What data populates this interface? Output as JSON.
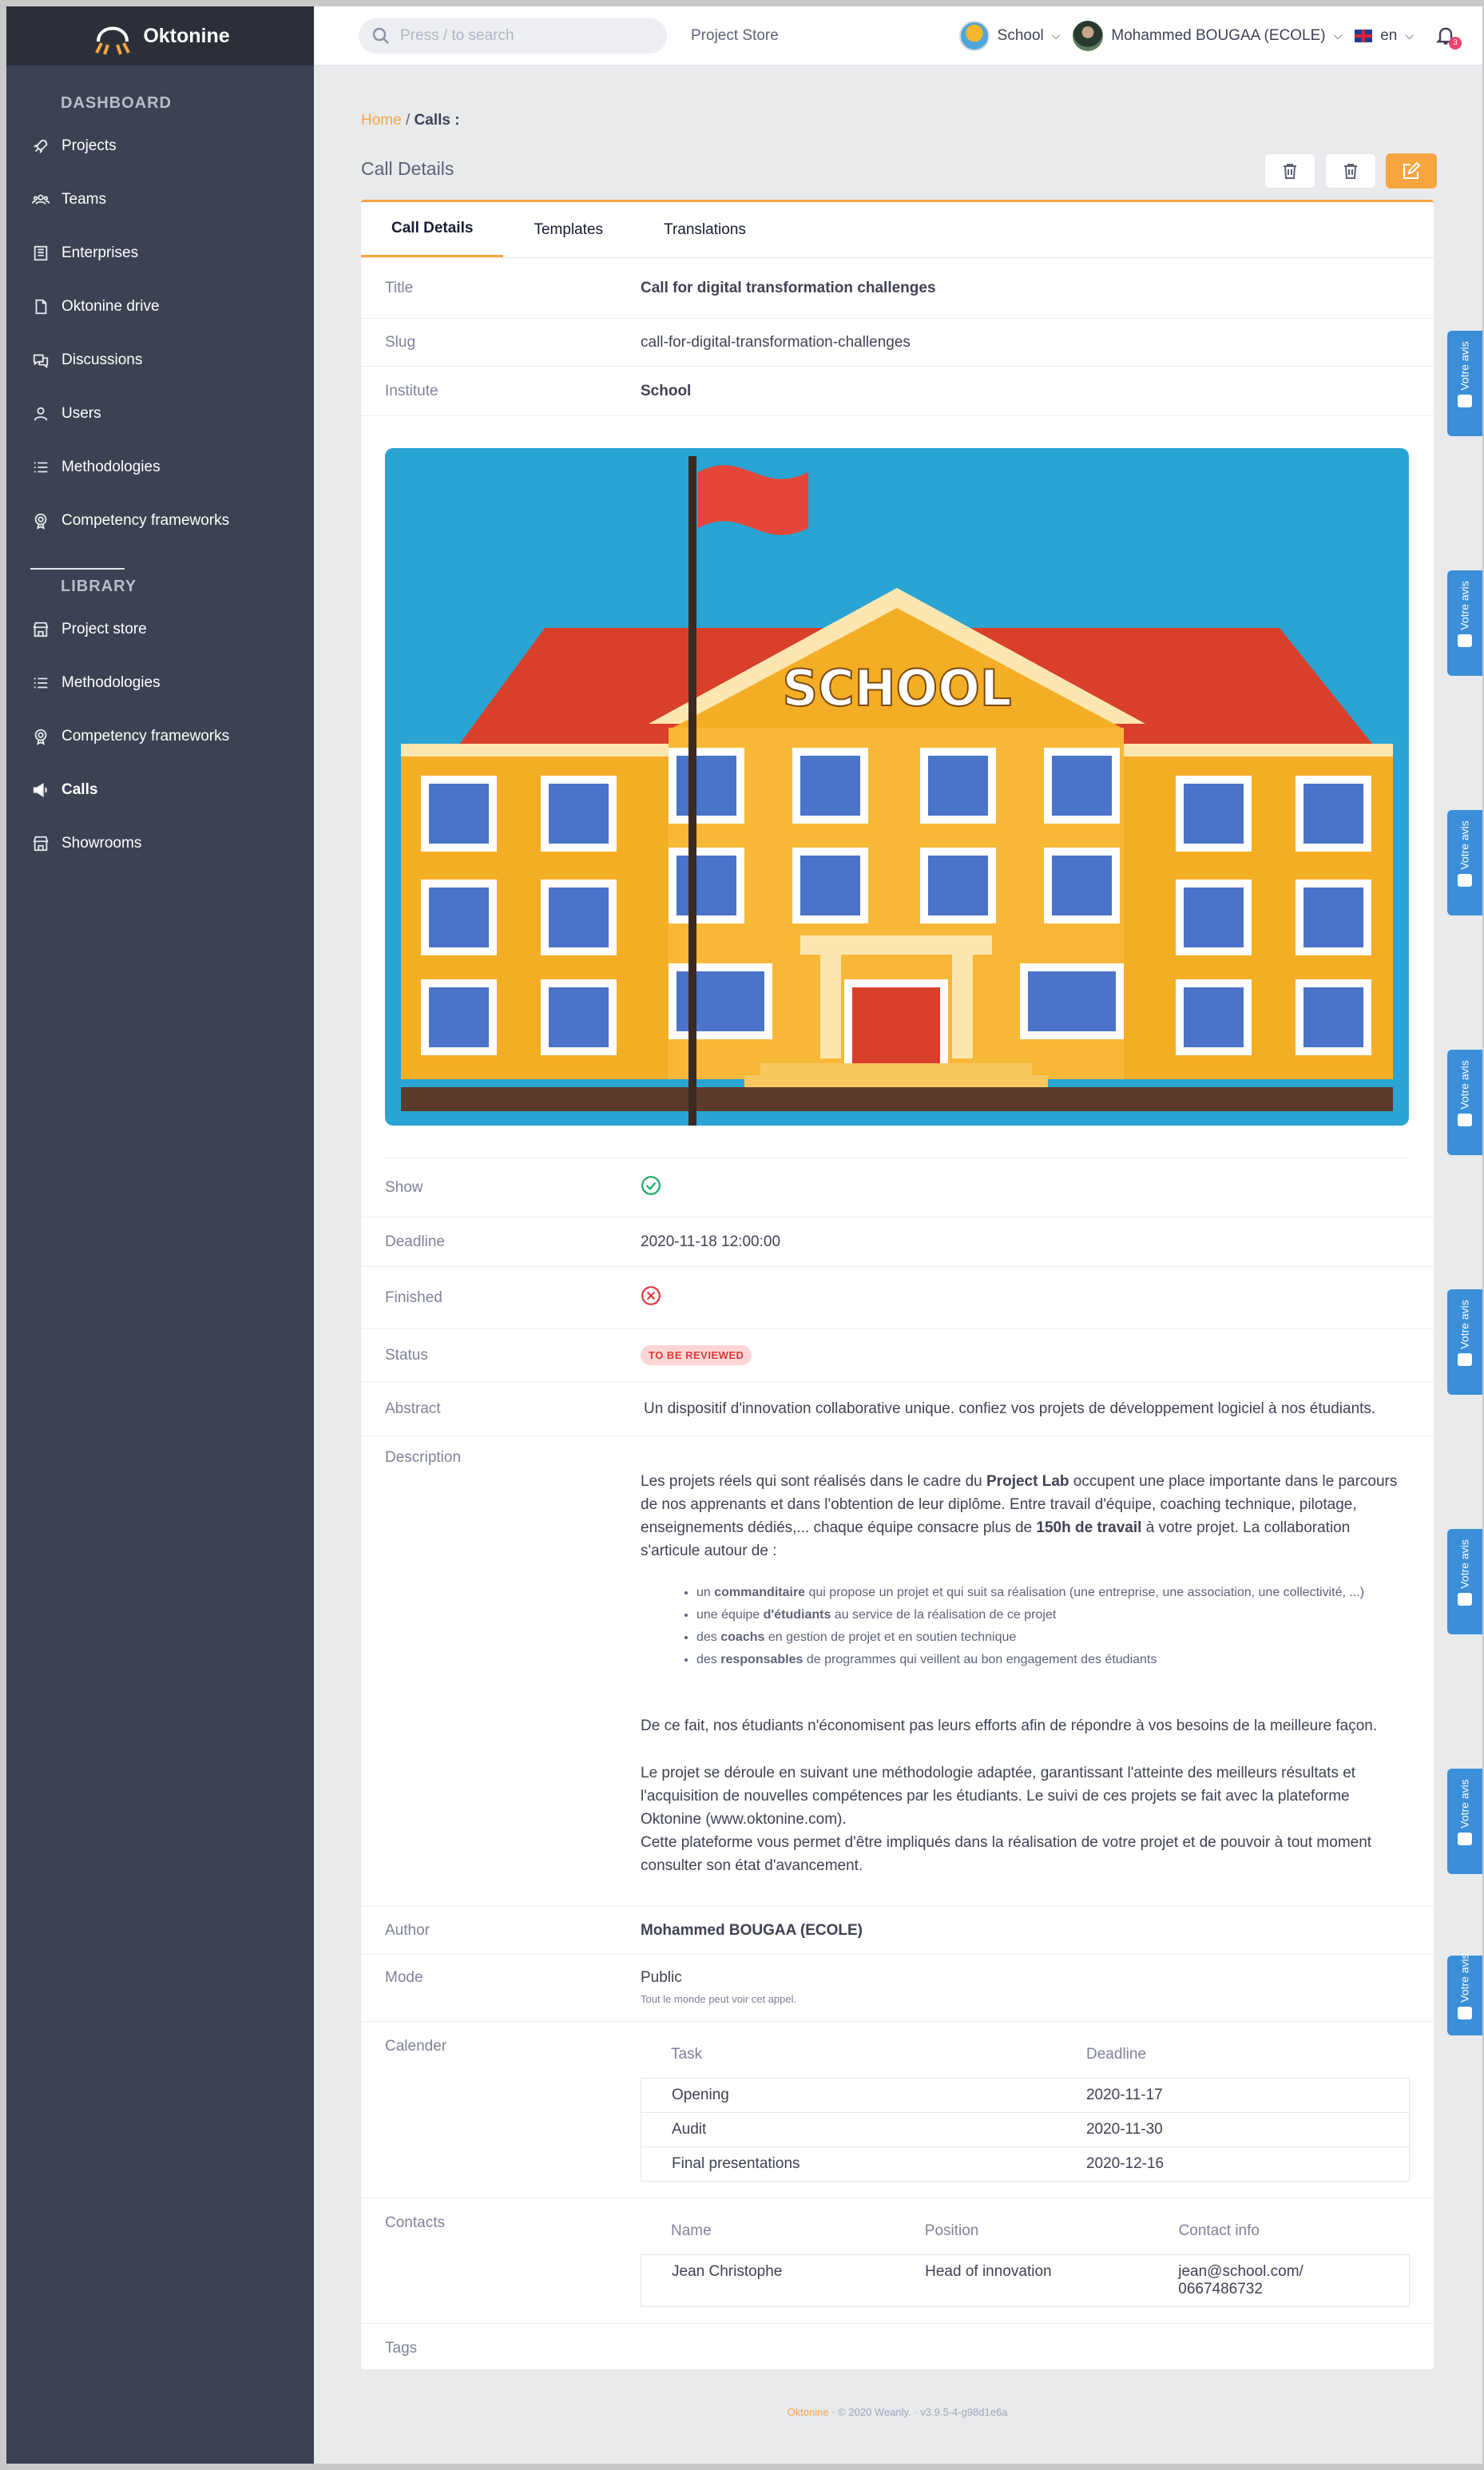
{
  "sidebar": {
    "brand": "Oktonine",
    "dashboard_title": "DASHBOARD",
    "dashboard_items": [
      {
        "label": "Projects",
        "icon": "rocket-icon"
      },
      {
        "label": "Teams",
        "icon": "users-group-icon"
      },
      {
        "label": "Enterprises",
        "icon": "building-icon"
      },
      {
        "label": "Oktonine drive",
        "icon": "drive-icon"
      },
      {
        "label": "Discussions",
        "icon": "chat-icon"
      },
      {
        "label": "Users",
        "icon": "user-icon"
      },
      {
        "label": "Methodologies",
        "icon": "list-icon"
      },
      {
        "label": "Competency frameworks",
        "icon": "badge-icon"
      }
    ],
    "library_title": "LIBRARY",
    "library_items": [
      {
        "label": "Project store",
        "icon": "store-icon"
      },
      {
        "label": "Methodologies",
        "icon": "list-icon"
      },
      {
        "label": "Competency frameworks",
        "icon": "badge-icon"
      },
      {
        "label": "Calls",
        "icon": "megaphone-icon",
        "active": true
      },
      {
        "label": "Showrooms",
        "icon": "store-icon"
      }
    ]
  },
  "header": {
    "search_placeholder": "Press / to search",
    "project_store": "Project Store",
    "institute": "School",
    "user": "Mohammed BOUGAA (ECOLE)",
    "language": "en",
    "notifications": "3"
  },
  "breadcrumb": {
    "home": "Home",
    "separator": "/",
    "current": "Calls :"
  },
  "page_title": "Call Details",
  "tabs": [
    "Call Details",
    "Templates",
    "Translations"
  ],
  "details": {
    "title_label": "Title",
    "title": "Call for digital transformation challenges",
    "slug_label": "Slug",
    "slug": "call-for-digital-transformation-challenges",
    "institute_label": "Institute",
    "institute": "School",
    "image_text": "SCHOOL",
    "show_label": "Show",
    "deadline_label": "Deadline",
    "deadline": "2020-11-18 12:00:00",
    "finished_label": "Finished",
    "status_label": "Status",
    "status": "TO BE REVIEWED",
    "abstract_label": "Abstract",
    "abstract": "Un dispositif d'innovation collaborative unique.  confiez vos projets de développement logiciel à nos étudiants.",
    "description_label": "Description",
    "description": {
      "p1_a": "Les projets réels qui sont réalisés dans le cadre du ",
      "p1_b": "Project Lab",
      "p1_c": " occupent une place importante dans le parcours de nos apprenants et dans l'obtention de leur diplôme. Entre travail d'équipe, coaching technique, pilotage, enseignements dédiés,... chaque équipe consacre plus de ",
      "p1_d": "150h de travail",
      "p1_e": " à votre projet. La collaboration s'articule autour de :",
      "bullets": [
        {
          "a": "un ",
          "b": "commanditaire",
          "c": " qui propose un projet et qui suit sa réalisation (une entreprise, une association, une collectivité, ...)"
        },
        {
          "a": "une équipe ",
          "b": "d'étudiants",
          "c": " au service de la réalisation de ce projet"
        },
        {
          "a": "des ",
          "b": "coachs",
          "c": " en gestion de projet et en soutien technique"
        },
        {
          "a": "des ",
          "b": "responsables",
          "c": " de programmes qui veillent au bon engagement des étudiants"
        }
      ],
      "p2": "De ce fait, nos étudiants n'économisent pas leurs efforts afin de répondre à vos besoins de la meilleure façon.",
      "p3": "Le projet se déroule en suivant une méthodologie adaptée, garantissant l'atteinte des meilleurs résultats et l'acquisition de nouvelles compétences par les étudiants. Le suivi de ces projets se fait avec la plateforme Oktonine (www.oktonine.com).",
      "p4": "Cette plateforme vous permet d'être impliqués dans la réalisation de votre projet et de pouvoir à tout moment consulter son état d'avancement."
    },
    "author_label": "Author",
    "author": "Mohammed BOUGAA (ECOLE)",
    "mode_label": "Mode",
    "mode": "Public",
    "mode_note": "Tout le monde peut voir cet appel.",
    "calendar_label": "Calender",
    "calendar_headers": [
      "Task",
      "Deadline"
    ],
    "calendar_rows": [
      {
        "task": "Opening",
        "deadline": "2020-11-17"
      },
      {
        "task": "Audit",
        "deadline": "2020-11-30"
      },
      {
        "task": "Final presentations",
        "deadline": "2020-12-16"
      }
    ],
    "contacts_label": "Contacts",
    "contacts_headers": [
      "Name",
      "Position",
      "Contact info"
    ],
    "contacts_rows": [
      {
        "name": "Jean Christophe",
        "position": "Head of innovation",
        "info_1": "jean@school.com/",
        "info_2": "0667486732"
      }
    ],
    "tags_label": "Tags"
  },
  "footer": {
    "brand": "Oktonine",
    "dot1": "·",
    "copyright": "© 2020 Weanly.",
    "dot2": "·",
    "version": "v3.9.5-4-g98d1e6a"
  },
  "feedback_label": "Votre avis",
  "colors": {
    "accent": "#f7a541",
    "sidebar": "#3b4252",
    "feedback": "#3b8ed8",
    "status_bg": "#fcd6d6",
    "status_text": "#d93b3b"
  }
}
